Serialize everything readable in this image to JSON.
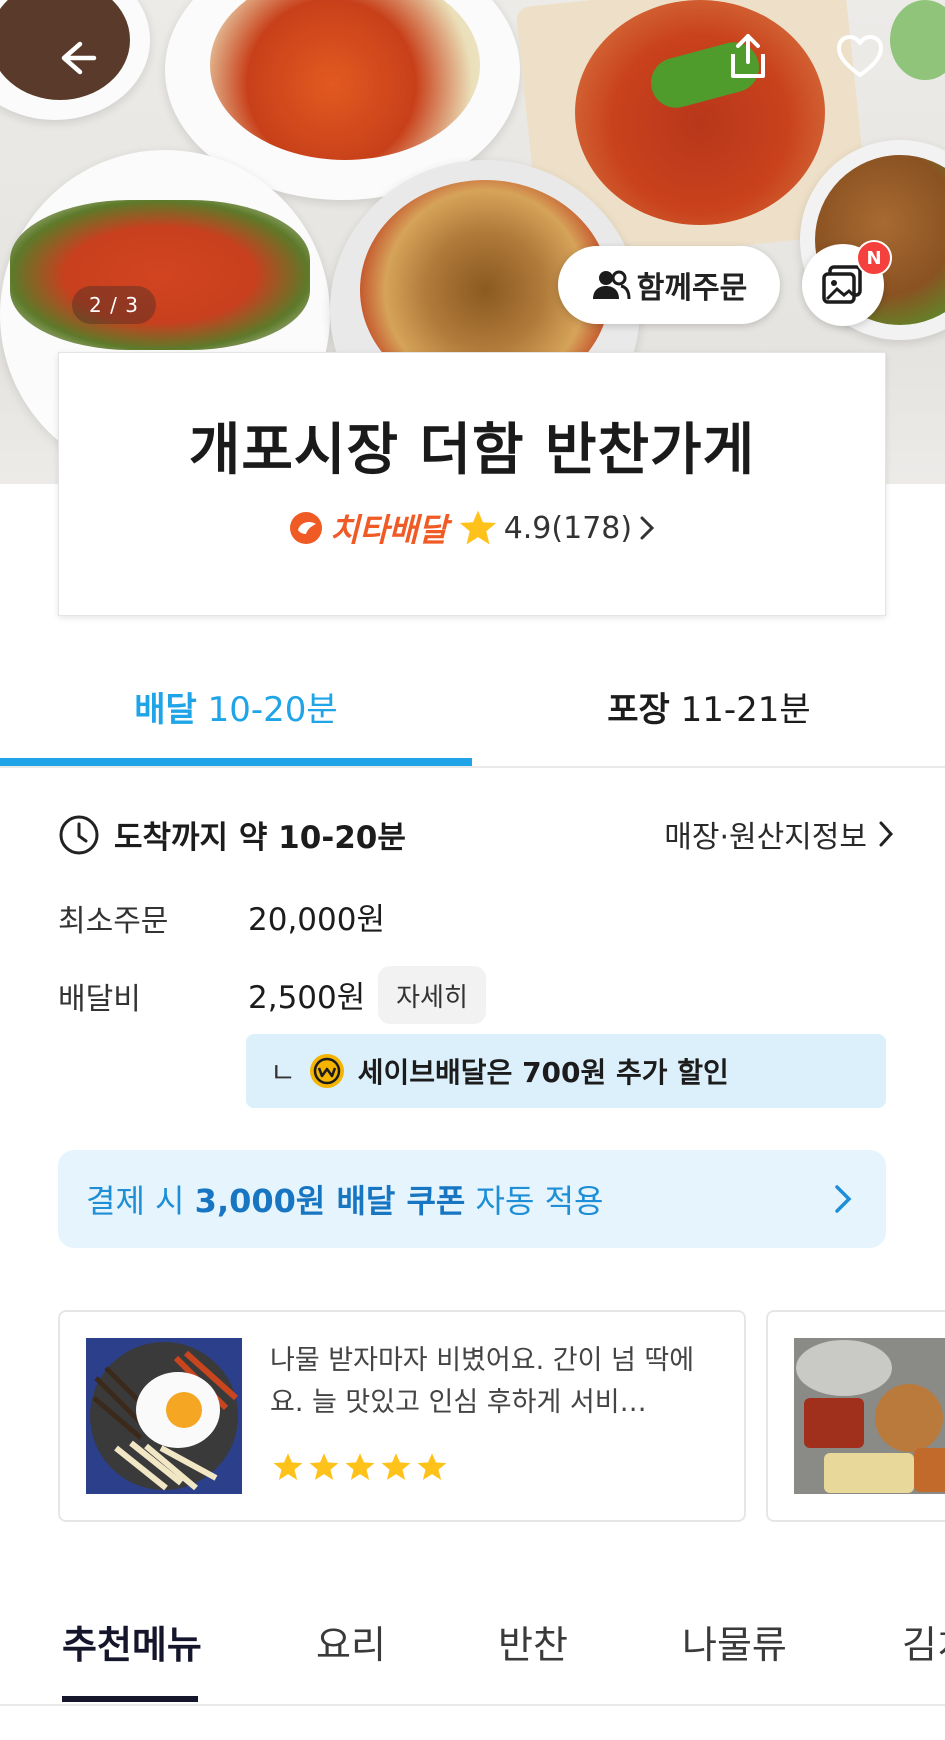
{
  "hero": {
    "photo_counter": "2 / 3",
    "group_order_label": "함께주문",
    "photo_badge": "N"
  },
  "store": {
    "name": "개포시장 더함 반찬가게",
    "delivery_brand": "치타배달",
    "rating": "4.9(178)",
    "brand_color": "#f05a24"
  },
  "delivery_tabs": [
    {
      "label": "배달",
      "time": "10-20분",
      "active": true
    },
    {
      "label": "포장",
      "time": "11-21분",
      "active": false
    }
  ],
  "info": {
    "arrival_label": "도착까지 약 10-20분",
    "store_info_link": "매장·원산지정보",
    "min_order_label": "최소주문",
    "min_order_value": "20,000원",
    "delivery_fee_label": "배달비",
    "delivery_fee_value": "2,500원",
    "detail_button": "자세히",
    "save_prefix": "ㄴ",
    "save_text": "세이브배달은 700원 추가 할인"
  },
  "coupon": {
    "prefix": "결제 시 ",
    "highlight": "3,000원 배달 쿠폰",
    "suffix": " 자동 적용"
  },
  "reviews": [
    {
      "text": "나물 받자마자 비볐어요. 간이 넘 딱에요. 늘 맛있고 인심 후하게 서비…",
      "rating": 5
    }
  ],
  "menu_tabs": [
    "추천메뉴",
    "요리",
    "반찬",
    "나물류",
    "김치"
  ],
  "colors": {
    "accent": "#1ea4e7",
    "coupon_bg": "#e6f5fd",
    "save_bg": "#dcf0fc",
    "star": "#ffc21a",
    "badge": "#f5413d"
  }
}
